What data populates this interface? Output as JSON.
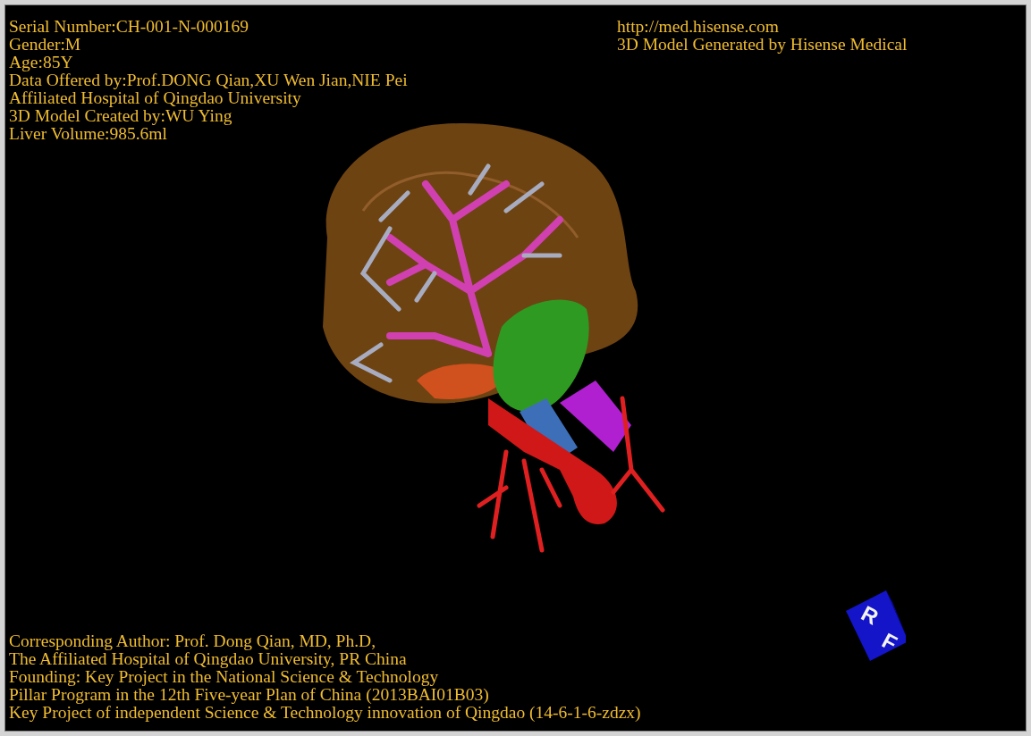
{
  "info_top_left": [
    "Serial Number:CH-001-N-000169",
    "Gender:M",
    "Age:85Y",
    "Data Offered by:Prof.DONG Qian,XU Wen Jian,NIE Pei",
    "Affiliated Hospital of Qingdao University",
    "3D Model Created by:WU Ying",
    "Liver Volume:985.6ml"
  ],
  "info_top_right": [
    "http://med.hisense.com",
    "3D Model Generated by Hisense Medical"
  ],
  "info_bottom_left": [
    "Corresponding Author: Prof. Dong Qian, MD, Ph.D,",
    "The Affiliated Hospital of Qingdao University, PR China",
    "Founding: Key Project in the National Science & Technology",
    "Pillar Program in the 12th Five-year Plan of China (2013BAI01B03)",
    "Key Project of independent Science & Technology innovation of Qingdao (14-6-1-6-zdzx)"
  ],
  "orientation_cube": {
    "faces": [
      "R",
      "F"
    ]
  }
}
